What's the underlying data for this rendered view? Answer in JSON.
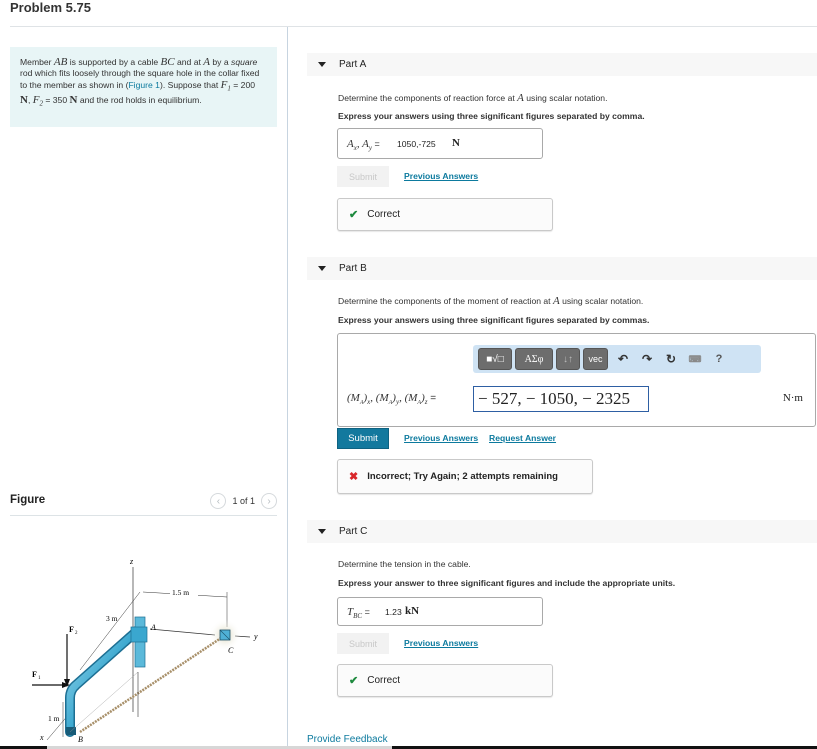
{
  "page": {
    "title": "Problem 5.75"
  },
  "problem": {
    "text_1": "Member ",
    "var_AB": "AB",
    "text_2": " is supported by a cable ",
    "var_BC": "BC",
    "text_3": " and at ",
    "var_A": "A",
    "text_4": " by a ",
    "text_square": "square",
    "text_5": " rod which fits loosely through the square hole in the collar fixed to the member as shown in (",
    "figure_link": "Figure 1",
    "text_6": "). Suppose that ",
    "var_F1": "F",
    "sub_1": "1",
    "text_7": " = 200 ",
    "unit_N1": "N",
    "text_8": ", ",
    "var_F2": "F",
    "sub_2": "2",
    "text_9": " = 350 ",
    "unit_N2": "N",
    "text_10": " and the rod holds in equilibrium."
  },
  "figure": {
    "title": "Figure",
    "counter": "1 of 1",
    "prev_icon": "chevron-left-icon",
    "next_icon": "chevron-right-icon",
    "labels": {
      "z": "z",
      "y": "y",
      "x": "x",
      "A": "A",
      "B": "B",
      "C": "C",
      "F1": "F",
      "F1_sub": "1",
      "F2": "F",
      "F2_sub": "2",
      "dim_3m": "3 m",
      "dim_1_5m": "1.5 m",
      "dim_1m": "1 m"
    }
  },
  "parts": [
    {
      "label": "Part A",
      "prompt_pre": "Determine the components of reaction force at ",
      "prompt_var": "A",
      "prompt_post": " using scalar notation.",
      "instruction": "Express your answers using three significant figures separated by comma.",
      "answer_label": "Ax, Ay =",
      "answer_value": "1050,-725",
      "answer_unit": "N",
      "submit_label": "Submit",
      "submit_enabled": false,
      "previous_answers": "Previous Answers",
      "feedback": {
        "status": "correct",
        "icon": "check-icon",
        "text": "Correct",
        "color": "#1e8a3e"
      }
    },
    {
      "label": "Part B",
      "prompt_pre": "Determine the components of the moment of reaction at ",
      "prompt_var": "A",
      "prompt_post": " using scalar notation.",
      "instruction": "Express your answers using three significant figures separated by commas.",
      "answer_label": "(MA)x, (MA)y, (MA)z =",
      "answer_value": "− 527, − 1050, − 2325",
      "answer_unit": "N·m",
      "toolbar": {
        "template_btn": "■√□",
        "greek_btn": "AΣφ",
        "arrows_btn": "↓↑",
        "vec_btn": "vec",
        "undo_icon": "undo-icon",
        "redo_icon": "redo-icon",
        "reset_icon": "reset-icon",
        "keyboard_icon": "keyboard-icon",
        "help_label": "?"
      },
      "submit_label": "Submit",
      "submit_enabled": true,
      "previous_answers": "Previous Answers",
      "request_answer": "Request Answer",
      "feedback": {
        "status": "incorrect",
        "icon": "x-icon",
        "text": "Incorrect; Try Again; 2 attempts remaining",
        "color": "#d9262a"
      }
    },
    {
      "label": "Part C",
      "prompt": "Determine the tension in the cable.",
      "instruction": "Express your answer to three significant figures and include the appropriate units.",
      "answer_label": "TBC =",
      "answer_value": "1.23",
      "answer_unit": "kN",
      "submit_label": "Submit",
      "submit_enabled": false,
      "previous_answers": "Previous Answers",
      "feedback": {
        "status": "correct",
        "icon": "check-icon",
        "text": "Correct",
        "color": "#1e8a3e"
      }
    }
  ],
  "footer": {
    "provide_feedback": "Provide Feedback"
  },
  "colors": {
    "accent": "#13799e",
    "link": "#0c7a9e",
    "problem_bg": "#e8f5f6",
    "correct": "#1e8a3e",
    "incorrect": "#d9262a"
  }
}
